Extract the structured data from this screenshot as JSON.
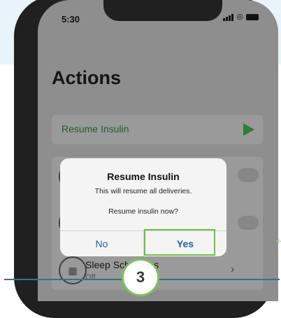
{
  "status_bar": {
    "time": "5:30"
  },
  "page": {
    "title": "Actions"
  },
  "resume_row": {
    "label": "Resume Insulin"
  },
  "rows": [
    {
      "title": "Sleep Schedules",
      "subtitle": "Off"
    }
  ],
  "dialog": {
    "title": "Resume Insulin",
    "message": "This will resume all deliveries.",
    "question": "Resume insulin now?",
    "no_label": "No",
    "yes_label": "Yes"
  },
  "step": {
    "number": "3"
  },
  "colors": {
    "play_green": "#2f7d37",
    "highlight_green": "#6fbf46",
    "button_blue": "#1f5fa3"
  }
}
